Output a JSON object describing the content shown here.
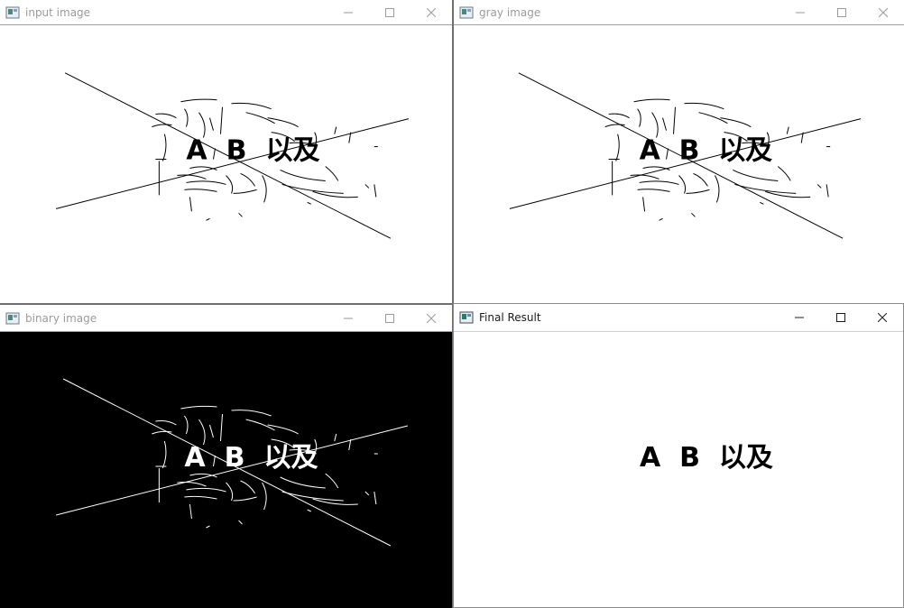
{
  "windows": {
    "input": {
      "title": "input image"
    },
    "gray": {
      "title": "gray image"
    },
    "binary": {
      "title": "binary image"
    },
    "final": {
      "title": "Final Result"
    }
  },
  "image_text": "A  B  以及",
  "colors": {
    "white_bg": "#ffffff",
    "black_bg": "#000000",
    "inactive_title": "#9a9a9a",
    "active_title": "#1a1a1a",
    "separator": "#6e6e6e"
  },
  "icons": {
    "app": "opencv-window-icon",
    "minimize": "minimize-icon",
    "maximize": "maximize-icon",
    "close": "close-icon"
  }
}
